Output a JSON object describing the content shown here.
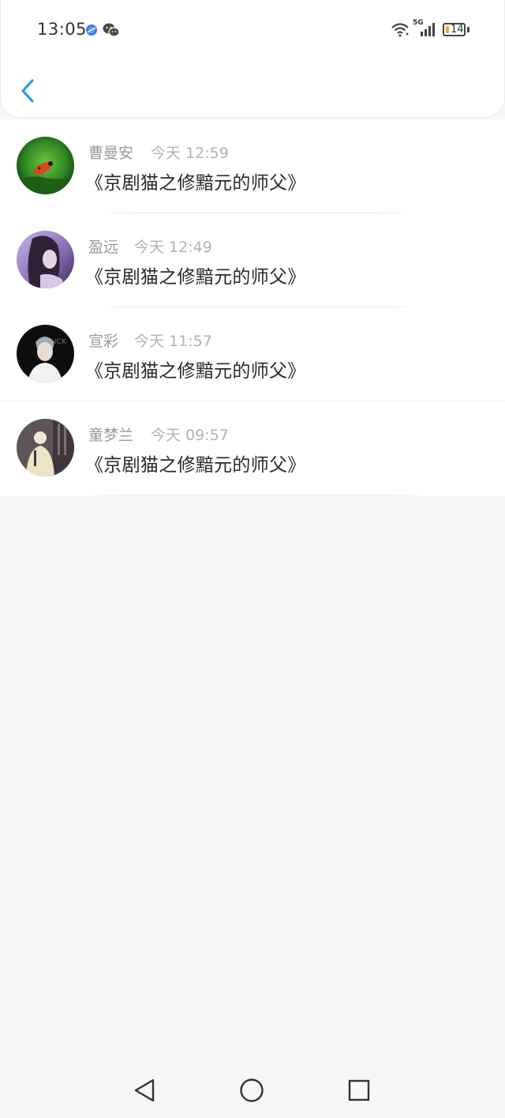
{
  "status_bar": {
    "time": "13:05",
    "network": "5G",
    "battery": "14",
    "icons": [
      "browser-notification-icon",
      "wechat-notification-icon",
      "wifi-icon",
      "signal-icon",
      "battery-icon"
    ]
  },
  "header": {
    "back_icon": "chevron-left-icon",
    "accent_color": "#2f9be6"
  },
  "messages": [
    {
      "name": "曹曼安",
      "time": "今天 12:59",
      "text": "《京剧猫之修黯元的师父》",
      "avatar": "avatar-ladybug"
    },
    {
      "name": "盈远",
      "time": "今天 12:49",
      "text": "《京剧猫之修黯元的师父》",
      "avatar": "avatar-girl-purple"
    },
    {
      "name": "宣彩",
      "time": "今天 11:57",
      "text": "《京剧猫之修黯元的师父》",
      "avatar": "avatar-boy-dark"
    },
    {
      "name": "童梦兰",
      "time": "今天 09:57",
      "text": "《京剧猫之修黯元的师父》",
      "avatar": "avatar-figure-room"
    }
  ],
  "nav": {
    "icons": [
      "nav-back-icon",
      "nav-home-icon",
      "nav-recents-icon"
    ]
  }
}
